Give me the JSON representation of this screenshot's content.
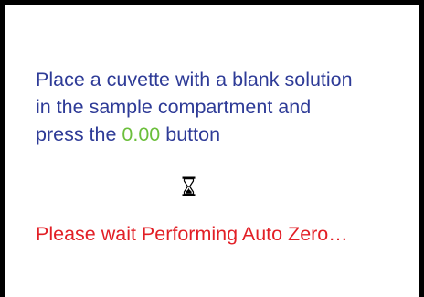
{
  "screen": {
    "instruction_lines": [
      "Place a cuvette with a blank solution",
      "in the sample compartment and",
      "press the"
    ],
    "button_value": "0.00",
    "button_suffix": "button",
    "status_icon": "hourglass-icon",
    "wait_message": "Please wait Performing Auto Zero…"
  },
  "colors": {
    "instruction_text": "#2e3b97",
    "button_value": "#6bbf3b",
    "wait_message": "#e21f26",
    "frame": "#000000"
  }
}
